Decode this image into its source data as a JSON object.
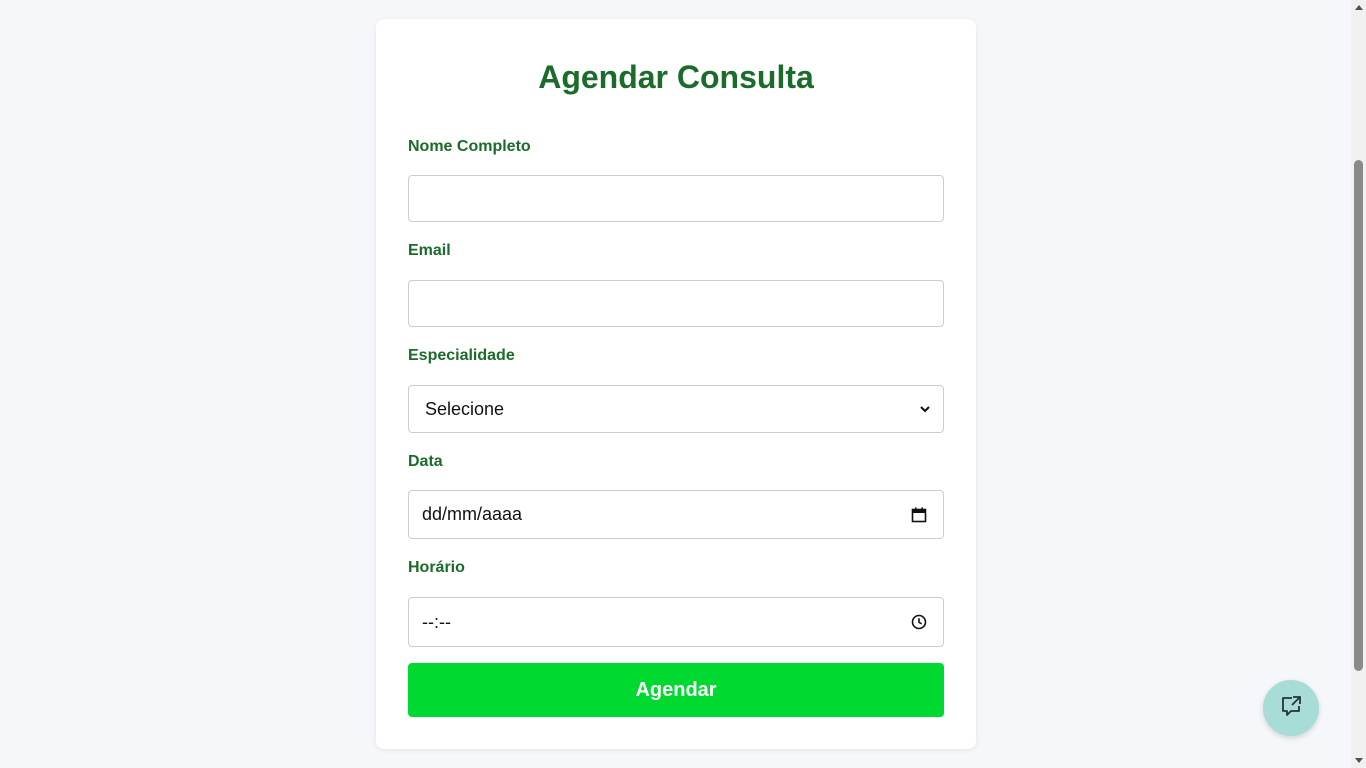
{
  "form": {
    "title": "Agendar Consulta",
    "name_label": "Nome Completo",
    "name_value": "",
    "email_label": "Email",
    "email_value": "",
    "specialty_label": "Especialidade",
    "specialty_selected": "Selecione",
    "date_label": "Data",
    "date_placeholder": "dd/mm/aaaa",
    "time_label": "Horário",
    "time_placeholder": "--:--",
    "submit_label": "Agendar"
  },
  "icons": {
    "select": "chevron-down-icon",
    "date": "calendar-icon",
    "time": "clock-icon",
    "chat": "chat-external-icon"
  },
  "colors": {
    "accent_text": "#1b6b2a",
    "submit_bg": "#00d930",
    "fab_bg": "#a8dcd7",
    "page_bg": "#f5f7fa"
  }
}
